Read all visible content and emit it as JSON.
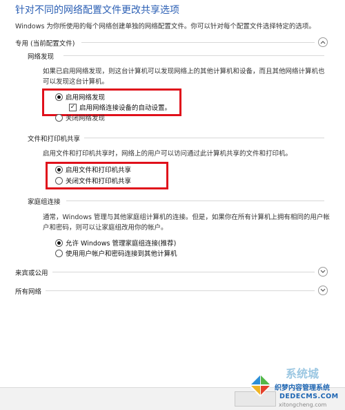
{
  "header": {
    "title": "针对不同的网络配置文件更改共享选项",
    "description": "Windows 为你所使用的每个网络创建单独的网络配置文件。你可以针对每个配置文件选择特定的选项。"
  },
  "private": {
    "label": "专用 (当前配置文件)",
    "discovery": {
      "heading": "网络发现",
      "text_line1": "如果已启用网络发现，则这台计算机可以发现网络上的其他计算机和设备，而且其他网络计算机也",
      "text_line2": "可以发现这台计算机。",
      "on_label": "启用网络发现",
      "auto_label": "启用网络连接设备的自动设置。",
      "off_label": "关闭网络发现"
    },
    "file_sharing": {
      "heading": "文件和打印机共享",
      "text": "启用文件和打印机共享时，网络上的用户可以访问通过此计算机共享的文件和打印机。",
      "on_label": "启用文件和打印机共享",
      "off_label": "关闭文件和打印机共享"
    },
    "homegroup": {
      "heading": "家庭组连接",
      "text_line1": "通常，Windows 管理与其他家庭组计算机的连接。但是，如果你在所有计算机上拥有相同的用户帐",
      "text_line2": "户和密码，则可以让家庭组改用你的帐户。",
      "allow_label": "允许 Windows 管理家庭组连接(推荐)",
      "use_account_label": "使用用户帐户和密码连接到其他计算机"
    }
  },
  "guest": {
    "label": "来宾或公用"
  },
  "all": {
    "label": "所有网络"
  },
  "watermark": {
    "line1": "织梦内容管理系统",
    "line2": "DEDECMS.COM",
    "brand": "系统城",
    "url_partial": "xitongcheng.com"
  }
}
